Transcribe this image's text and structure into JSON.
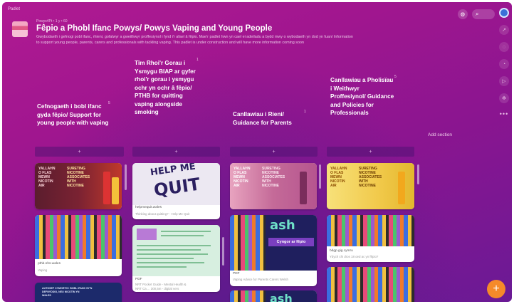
{
  "app": {
    "brand": "Padlet"
  },
  "topbar": {
    "settings_icon": "gear-icon",
    "search_icon": "search-icon"
  },
  "rail": {
    "avatar": "avatar",
    "icons": [
      "share-icon",
      "comment-icon",
      "bell-icon",
      "play-icon",
      "gear-icon"
    ],
    "more": "•••"
  },
  "board": {
    "meta": "Powys4Pt • 1 y • 60",
    "title": "Fêpio a Phobl Ifanc Powys/ Powys Vaping and Young People",
    "description_line1": "Gwybodaeth i gefnogi pobl ifanc, rhieni, gofalwyr a gweithwyr proffesiynol i fynd i'r afael â fêpio. Mae'r padlet hwn yn cael ei adeiladu a bydd mwy o wybodaeth yn dod yn fuan/ Information",
    "description_line2": "to support young people, parents, carers and professionals with tackling vaping. This padlet is under construction and will have more information coming soon"
  },
  "columns": [
    {
      "title": "Cefnogaeth i bobl ifanc gyda fêpio/ Support for young people with vaping",
      "count": "5"
    },
    {
      "title": "Tîm Rhoi'r Gorau i Ysmygu BIAP ar gyfer rhoi'r gorau i ysmygu ochr yn ochr â fêpio/ PTHB for quitting vaping alongside smoking",
      "count": "1"
    },
    {
      "title": "Canllawiau i Rieni/ Guidance for Parents",
      "count": "1"
    },
    {
      "title": "Canllawiau a Pholisïau i Weithwyr Proffesiynol/ Guidance and Policies for Professionals",
      "count": "5"
    }
  ],
  "add_label": "+",
  "add_section_label": "Add section",
  "cards": {
    "c1a": {
      "poster_words": "YALLAHN\nO FLAS\nMEWN\nNICOTIN\nAIR",
      "poster_words2": "SURETING\nNICOTINE\nASSOCIATES\nWITH\nNICOTINE"
    },
    "c1b": {
      "caption": "pthb.nhs.wales",
      "caption2": "Vaping"
    },
    "c1c": {
      "poster_words": "AUTOSEF CYMORTH I BOBL IFANC SY'N\nDEFNYDDIO, NEU NICOTIN YN\nWALES"
    },
    "c2a": {
      "quit_text": "HELP ME",
      "quit_big": "QUIT",
      "caption": "helpmequit.wales",
      "caption2": "Thinking about quitting? - Help Me Quit"
    },
    "c2b": {
      "caption": "PDF",
      "caption2": "NRT Pocket Guide - Mental Health &",
      "caption3": "NRT Ca ... 300,5m - digital vers"
    },
    "c3a": {
      "poster_words": "YALLAHN\nO FLAS\nMEWN\nNICOTIN\nAIR",
      "poster_words2": "SURETING\nNICOTINE\nASSOCIATES\nWITH\nNICOTINE"
    },
    "c3b": {
      "ash_word": "ash",
      "subtitle": "Cyngor ar fêpio",
      "caption": "PDF",
      "caption2": "Vaping Advice for Parents Carers Welsh"
    },
    "c3c": {
      "ash_word": "ash"
    },
    "c4a": {
      "poster_words": "YALLAHN\nO FLAS\nMEWN\nNICOTIN\nAIR",
      "poster_words2": "SURETING\nNICOTINE\nASSOCIATES\nWITH\nNICOTINE"
    },
    "c4b": {
      "caption": "bdgp.gig.cymru",
      "caption2": "Ydych chi dros 18 oed ac yn fêpio?"
    }
  },
  "fab_label": "+"
}
